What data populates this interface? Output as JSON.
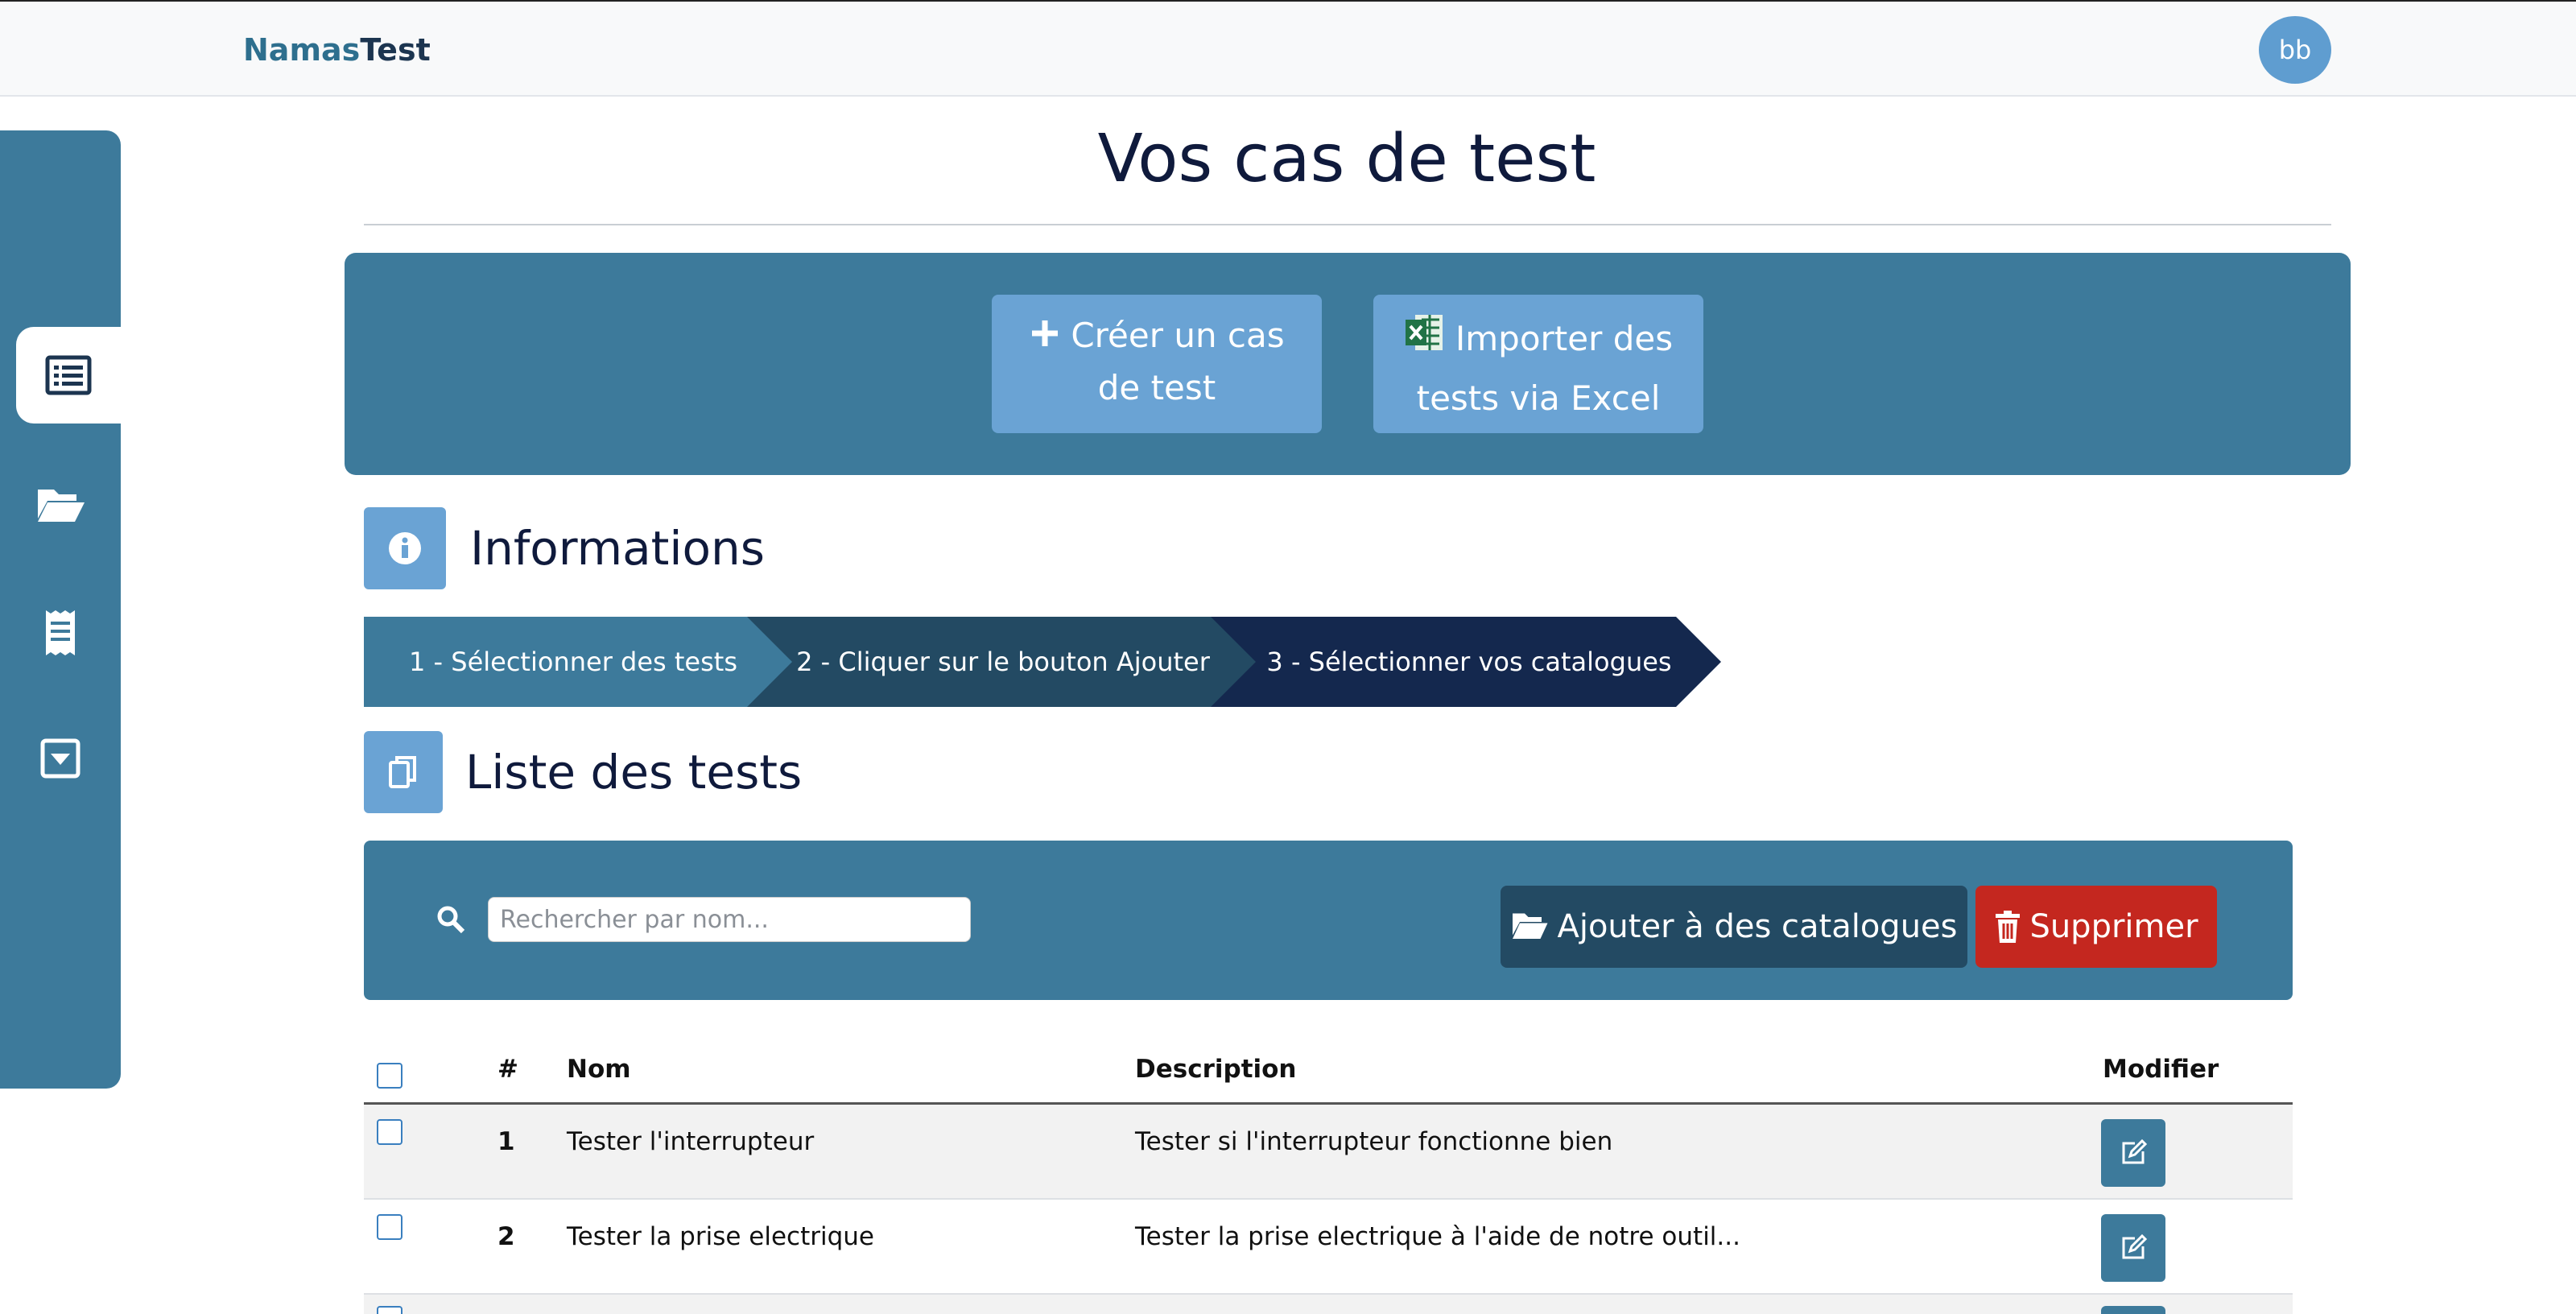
{
  "header": {
    "logo_part1": "Namas",
    "logo_part2": "Test",
    "avatar_initials": "bb"
  },
  "sidebar": {
    "items": [
      {
        "icon": "sitemap-icon",
        "active": false
      },
      {
        "icon": "list-icon",
        "active": true
      },
      {
        "icon": "folder-open-icon",
        "active": false
      },
      {
        "icon": "receipt-icon",
        "active": false
      },
      {
        "icon": "caret-square-down-icon",
        "active": false
      }
    ]
  },
  "page": {
    "title": "Vos cas de test"
  },
  "actions": {
    "create_label_line1": "Créer un cas",
    "create_label_line2": "de test",
    "import_label_line1": "Importer des",
    "import_label_line2": "tests via Excel"
  },
  "info": {
    "title": "Informations",
    "steps": [
      "1 - Sélectionner des tests",
      "2 - Cliquer sur le bouton Ajouter",
      "3 - Sélectionner vos catalogues"
    ]
  },
  "list": {
    "title": "Liste des tests",
    "search_placeholder": "Rechercher par nom...",
    "add_to_catalog_label": "Ajouter à des catalogues",
    "delete_label": "Supprimer",
    "columns": {
      "num": "#",
      "name": "Nom",
      "description": "Description",
      "edit": "Modifier"
    },
    "rows": [
      {
        "num": "1",
        "name": "Tester l'interrupteur",
        "description": "Tester si l'interrupteur fonctionne bien"
      },
      {
        "num": "2",
        "name": "Tester la prise electrique",
        "description": "Tester la prise electrique à l'aide de notre outil..."
      }
    ]
  },
  "colors": {
    "primary": "#3d7a9b",
    "light_button": "#6aa3d4",
    "dark_navy": "#0f1a3c",
    "danger": "#c4271f"
  }
}
